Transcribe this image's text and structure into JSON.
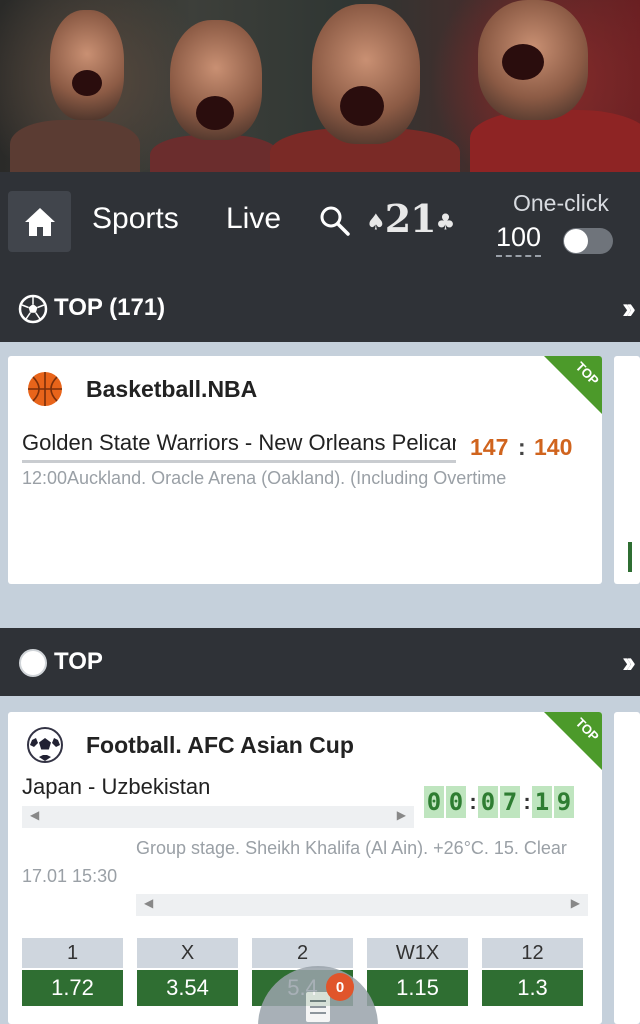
{
  "navbar": {
    "sports_label": "Sports",
    "live_label": "Live",
    "logo_text": "21",
    "one_click_label": "One-click",
    "one_click_amount": "100",
    "one_click_enabled": false
  },
  "sections": [
    {
      "title": "TOP (171)",
      "cards": [
        {
          "league": "Basketball.NBA",
          "badge": "TOP",
          "teams": "Golden State Warriors - New Orleans Pelicans",
          "score_home": "147",
          "score_sep": ":",
          "score_away": "140",
          "info": "12:00Auckland. Oracle Arena (Oakland). (Including Overtime"
        }
      ]
    },
    {
      "title": "TOP",
      "cards": [
        {
          "league": "Football. AFC Asian Cup",
          "badge": "TOP",
          "teams": "Japan - Uzbekistan",
          "timer": [
            "0",
            "0",
            ":",
            "0",
            "7",
            ":",
            "1",
            "9"
          ],
          "info": "Group stage. Sheikh Khalifa (Al Ain). +26°C. 15. Clear",
          "datetime": "17.01 15:30",
          "odds": [
            {
              "label": "1",
              "value": "1.72"
            },
            {
              "label": "X",
              "value": "3.54"
            },
            {
              "label": "2",
              "value": "5.4"
            },
            {
              "label": "W1X",
              "value": "1.15"
            },
            {
              "label": "12",
              "value": "1.3"
            }
          ]
        }
      ]
    }
  ],
  "betslip": {
    "count": "0"
  },
  "colors": {
    "navbar_bg": "#2f3237",
    "page_bg": "#c5d0db",
    "score": "#d0641e",
    "odds_green": "#2f6e32",
    "top_ribbon": "#4c9a2a",
    "badge": "#e0552b"
  }
}
